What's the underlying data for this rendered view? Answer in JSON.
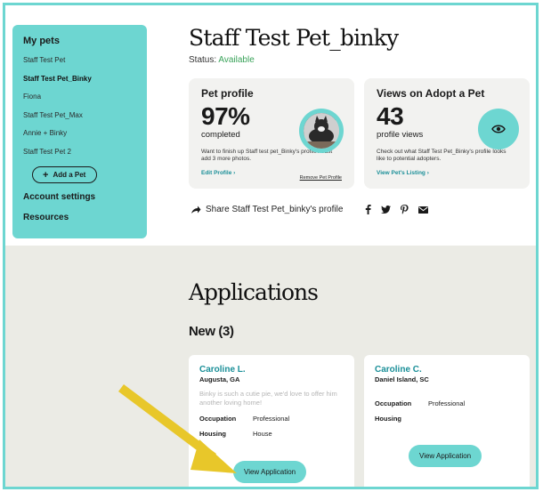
{
  "sidebar": {
    "title": "My pets",
    "pets": [
      "Staff Test Pet",
      "Staff Test Pet_Binky",
      "Fiona",
      "Staff Test Pet_Max",
      "Annie + Binky",
      "Staff Test Pet 2"
    ],
    "add_pet_label": "Add a Pet",
    "account_settings": "Account settings",
    "resources": "Resources"
  },
  "header": {
    "pet_name": "Staff Test Pet_binky",
    "status_label": "Status:",
    "status_value": "Available"
  },
  "profile_card": {
    "title": "Pet profile",
    "percent": "97%",
    "sub": "completed",
    "desc": "Want to finish up Staff test pet_Binky's profile? Just add 3 more photos.",
    "edit_link": "Edit Profile  ›",
    "remove_link": "Remove Pet Profile"
  },
  "views_card": {
    "title": "Views on Adopt a Pet",
    "count": "43",
    "sub": "profile views",
    "desc": "Check out what Staff Test Pet_Binky's profile looks like to potential adopters.",
    "link": "View Pet's Listing  ›"
  },
  "share": {
    "label": "Share Staff Test Pet_binky's profile",
    "icons": [
      "facebook-icon",
      "twitter-icon",
      "pinterest-icon",
      "email-icon"
    ]
  },
  "applications": {
    "title": "Applications",
    "new_label": "New (3)",
    "cards": [
      {
        "name": "Caroline L.",
        "location": "Augusta, GA",
        "message": "Binky is such a cutie pie, we'd love to offer him another loving home!",
        "occupation_label": "Occupation",
        "occupation": "Professional",
        "housing_label": "Housing",
        "housing": "House",
        "button": "View Application"
      },
      {
        "name": "Caroline C.",
        "location": "Daniel Island, SC",
        "occupation_label": "Occupation",
        "occupation": "Professional",
        "housing_label": "Housing",
        "housing": "",
        "button": "View Application"
      }
    ]
  },
  "colors": {
    "accent": "#6dd6d1",
    "link": "#1a8f98",
    "status": "#3aa35a",
    "arrow": "#e8c72a"
  }
}
